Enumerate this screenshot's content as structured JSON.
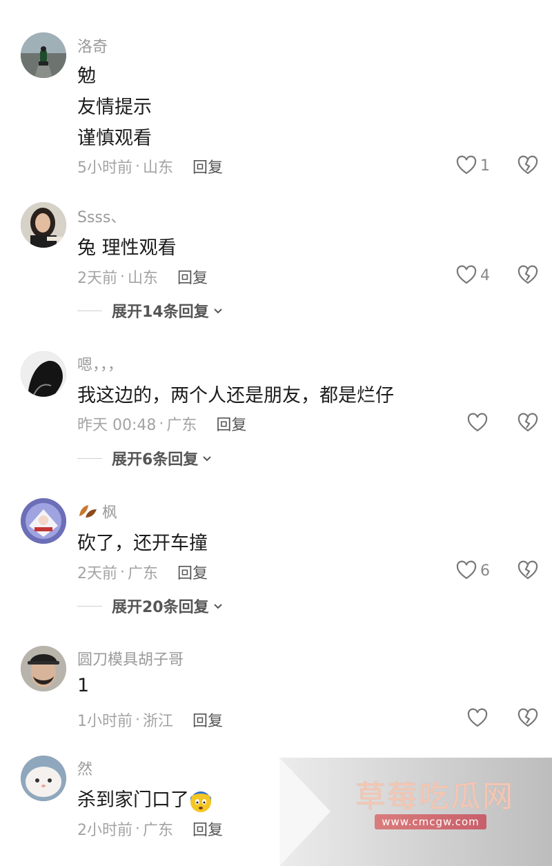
{
  "comments": [
    {
      "user": "洛奇",
      "lines": [
        "勉",
        "友情提示",
        "谨慎观看"
      ],
      "time": "5小时前",
      "location": "山东",
      "likes": "1",
      "expand": null,
      "avatar_icon": "motorcycle-road-avatar"
    },
    {
      "user": "Ssss、",
      "lines": [
        "兔   理性观看"
      ],
      "time": "2天前",
      "location": "山东",
      "likes": "4",
      "expand": "展开14条回复",
      "avatar_icon": "woman-eating-avatar"
    },
    {
      "user": "嗯，，，",
      "lines": [
        "我这边的，两个人还是朋友，都是烂仔"
      ],
      "time": "昨天 00:48",
      "location": "广东",
      "likes": "",
      "expand": "展开6条回复",
      "avatar_icon": "silhouette-avatar"
    },
    {
      "user": "枫",
      "lines": [
        "砍了，还开车撞"
      ],
      "time": "2天前",
      "location": "广东",
      "likes": "6",
      "expand": "展开20条回复",
      "avatar_icon": "anime-character-avatar",
      "name_icon": "leaves-icon"
    },
    {
      "user": "圆刀模具胡子哥",
      "lines": [
        "1"
      ],
      "time": "1小时前",
      "location": "浙江",
      "likes": "",
      "expand": null,
      "avatar_icon": "man-cap-avatar"
    },
    {
      "user": "然",
      "lines": [
        "杀到家门口了"
      ],
      "time": "2小时前",
      "location": "广东",
      "likes": "",
      "expand": null,
      "avatar_icon": "white-cat-avatar",
      "line_emoji": "scared-face-emoji"
    }
  ],
  "labels": {
    "reply": "回复",
    "separator": "·"
  },
  "watermark": {
    "title": "草莓吃瓜网",
    "url": "www.cmcgw.com"
  },
  "colors": {
    "meta_gray": "#a3a3a3",
    "text": "#1b1b1b",
    "watermark_title": "#f3c7b4",
    "watermark_badge": "#d97c7c"
  }
}
